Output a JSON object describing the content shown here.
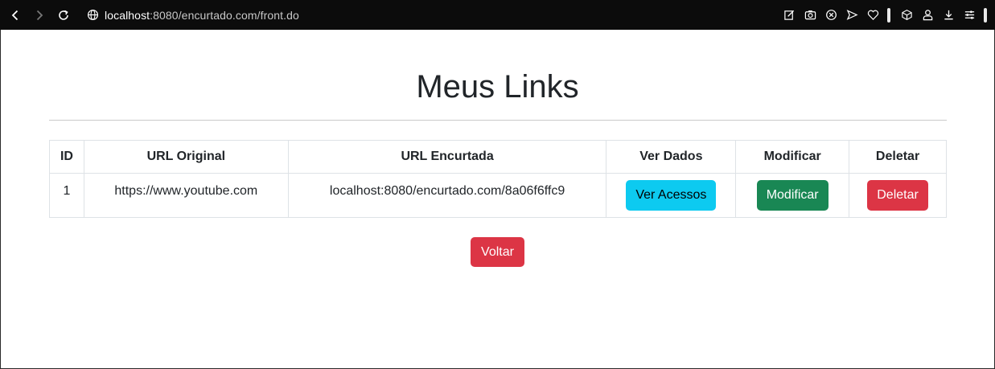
{
  "browser": {
    "url_host": "localhost",
    "url_rest": ":8080/encurtado.com/front.do",
    "icons": [
      "back-icon",
      "forward-icon",
      "reload-icon",
      "globe-icon",
      "edit-icon",
      "camera-icon",
      "block-icon",
      "send-icon",
      "heart-icon",
      "cube-icon",
      "profile-icon",
      "download-icon",
      "menu-icon"
    ]
  },
  "page": {
    "title": "Meus Links",
    "back_label": "Voltar"
  },
  "table": {
    "headers": [
      "ID",
      "URL Original",
      "URL Encurtada",
      "Ver Dados",
      "Modificar",
      "Deletar"
    ],
    "rows": [
      {
        "id": "1",
        "original": "https://www.youtube.com",
        "shortened": "localhost:8080/encurtado.com/8a06f6ffc9",
        "view_label": "Ver Acessos",
        "modify_label": "Modificar",
        "delete_label": "Deletar"
      }
    ]
  },
  "colors": {
    "info": "#0dcaf0",
    "success": "#198754",
    "danger": "#dc3545"
  }
}
